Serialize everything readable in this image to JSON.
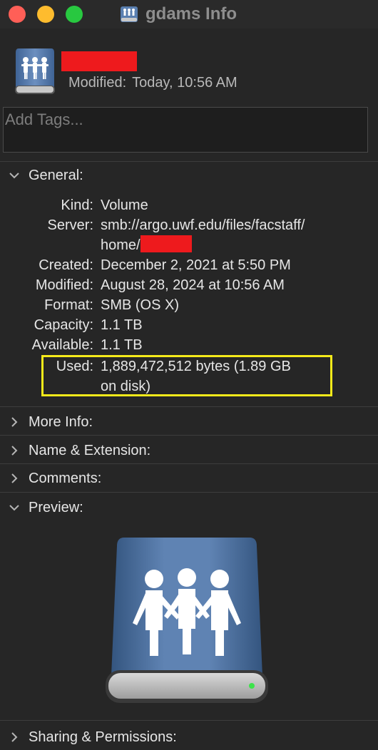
{
  "window": {
    "title": "gdams Info",
    "icon": "network-volume-icon"
  },
  "header": {
    "modified_label": "Modified:",
    "modified_value": "Today, 10:56 AM"
  },
  "tags": {
    "placeholder": "Add Tags..."
  },
  "sections": {
    "general": "General:",
    "more_info": "More Info:",
    "name_extension": "Name & Extension:",
    "comments": "Comments:",
    "preview": "Preview:",
    "sharing_permissions": "Sharing & Permissions:"
  },
  "general": {
    "kind_label": "Kind:",
    "kind_value": "Volume",
    "server_label": "Server:",
    "server_value_line1": "smb://argo.uwf.edu/files/facstaff/",
    "server_value_line2": "home/",
    "created_label": "Created:",
    "created_value": "December 2, 2021 at 5:50 PM",
    "modified_label": "Modified:",
    "modified_value": "August 28, 2024 at 10:56 AM",
    "format_label": "Format:",
    "format_value": "SMB (OS X)",
    "capacity_label": "Capacity:",
    "capacity_value": "1.1 TB",
    "available_label": "Available:",
    "available_value": "1.1 TB",
    "used_label": "Used:",
    "used_value_line1": "1,889,472,512 bytes (1.89 GB",
    "used_value_line2": "on disk)"
  },
  "colors": {
    "background": "#262626",
    "highlight_box": "#f5ea1a",
    "redaction": "#ee1a1d",
    "drive_blue": "#4a6f9e"
  }
}
